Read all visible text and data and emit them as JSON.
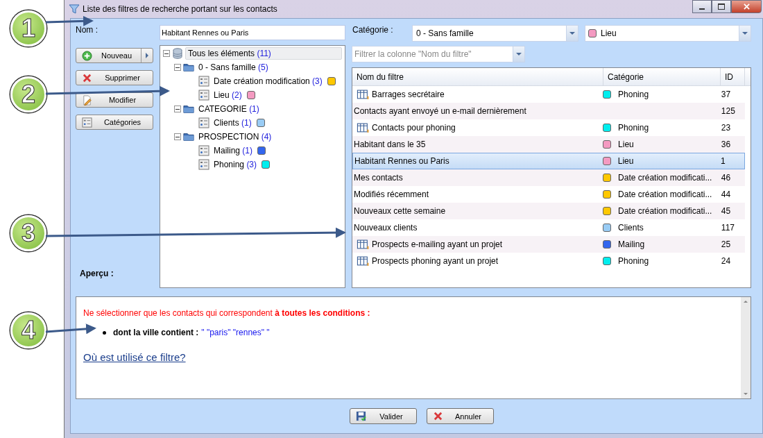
{
  "callouts": [
    {
      "number": "1"
    },
    {
      "number": "2"
    },
    {
      "number": "3"
    },
    {
      "number": "4"
    }
  ],
  "window": {
    "title": "Liste des filtres de recherche portant sur les contacts"
  },
  "name_field": {
    "label": "Nom :",
    "value": "Habitant Rennes ou Paris"
  },
  "category_field": {
    "label": "Catégorie :",
    "family": "0 - Sans famille",
    "category": "Lieu",
    "color": "#f49ac1"
  },
  "actions": [
    {
      "label": "Nouveau",
      "kind": "split"
    },
    {
      "label": "Supprimer",
      "kind": "delete"
    },
    {
      "label": "Modifier",
      "kind": "edit"
    },
    {
      "label": "Catégories",
      "kind": "categories"
    }
  ],
  "preview_label": "Aperçu :",
  "tree": [
    {
      "label": "Tous les éléments",
      "count": "(11)",
      "kind": "root",
      "selected": true,
      "expanded": true,
      "children": [
        {
          "label": "0 - Sans famille",
          "count": "(5)",
          "kind": "folder",
          "selected": false,
          "expanded": true,
          "children": [
            {
              "label": "Date création modification",
              "count": "(3)",
              "kind": "item",
              "selected": false,
              "color": "#ffc800"
            },
            {
              "label": "Lieu",
              "count": "(2)",
              "kind": "item",
              "selected": false,
              "color": "#f49ac1"
            }
          ]
        },
        {
          "label": "CATEGORIE",
          "count": "(1)",
          "kind": "folder",
          "selected": false,
          "expanded": true,
          "children": [
            {
              "label": "Clients",
              "count": "(1)",
              "kind": "item",
              "selected": false,
              "color": "#99ccf5"
            }
          ]
        },
        {
          "label": "PROSPECTION",
          "count": "(4)",
          "kind": "folder",
          "selected": false,
          "expanded": true,
          "children": [
            {
              "label": "Mailing",
              "count": "(1)",
              "kind": "item",
              "selected": false,
              "color": "#3366ee"
            },
            {
              "label": "Phoning",
              "count": "(3)",
              "kind": "item",
              "selected": false,
              "color": "#00eeee"
            }
          ]
        }
      ]
    }
  ],
  "column_filter": {
    "placeholder": "Filtrer la colonne \"Nom du filtre\""
  },
  "table": {
    "columns": [
      "Nom du filtre",
      "Catégorie",
      "ID"
    ],
    "rows": [
      {
        "name": "Barrages secrétaire",
        "kind": "shared",
        "category": "Phoning",
        "color": "#00eeee",
        "id": "37",
        "selected": false
      },
      {
        "name": "Contacts ayant envoyé un e-mail dernièrement",
        "kind": "plain",
        "id": "125",
        "selected": false
      },
      {
        "name": "Contacts pour phoning",
        "kind": "shared",
        "category": "Phoning",
        "color": "#00eeee",
        "id": "23",
        "selected": false
      },
      {
        "name": "Habitant dans le 35",
        "kind": "plain",
        "category": "Lieu",
        "color": "#f49ac1",
        "id": "36",
        "selected": false
      },
      {
        "name": "Habitant Rennes ou Paris",
        "kind": "plain",
        "category": "Lieu",
        "color": "#f49ac1",
        "id": "1",
        "selected": true
      },
      {
        "name": "Mes contacts",
        "kind": "plain",
        "category": "Date création modificati...",
        "color": "#ffc800",
        "id": "46",
        "selected": false
      },
      {
        "name": "Modifiés récemment",
        "kind": "plain",
        "category": "Date création modificati...",
        "color": "#ffc800",
        "id": "44",
        "selected": false
      },
      {
        "name": "Nouveaux cette semaine",
        "kind": "plain",
        "category": "Date création modificati...",
        "color": "#ffc800",
        "id": "45",
        "selected": false
      },
      {
        "name": "Nouveaux clients",
        "kind": "plain",
        "category": "Clients",
        "color": "#99ccf5",
        "id": "117",
        "selected": false
      },
      {
        "name": "Prospects e-mailing ayant un projet",
        "kind": "shared",
        "category": "Mailing",
        "color": "#3366ee",
        "id": "25",
        "selected": false
      },
      {
        "name": "Prospects phoning ayant un projet",
        "kind": "shared",
        "category": "Phoning",
        "color": "#00eeee",
        "id": "24",
        "selected": false
      }
    ]
  },
  "preview": {
    "intro": "Ne sélectionner que les contacts qui correspondent **à toutes les conditions :**",
    "conditions": [
      {
        "label": "dont la ville contient :",
        "value": "\" \"paris\" \"rennes\" \""
      }
    ],
    "link": "Où est utilisé ce filtre?"
  },
  "buttons": [
    {
      "label": "Valider",
      "kind": "save"
    },
    {
      "label": "Annuler",
      "kind": "cancel"
    }
  ]
}
